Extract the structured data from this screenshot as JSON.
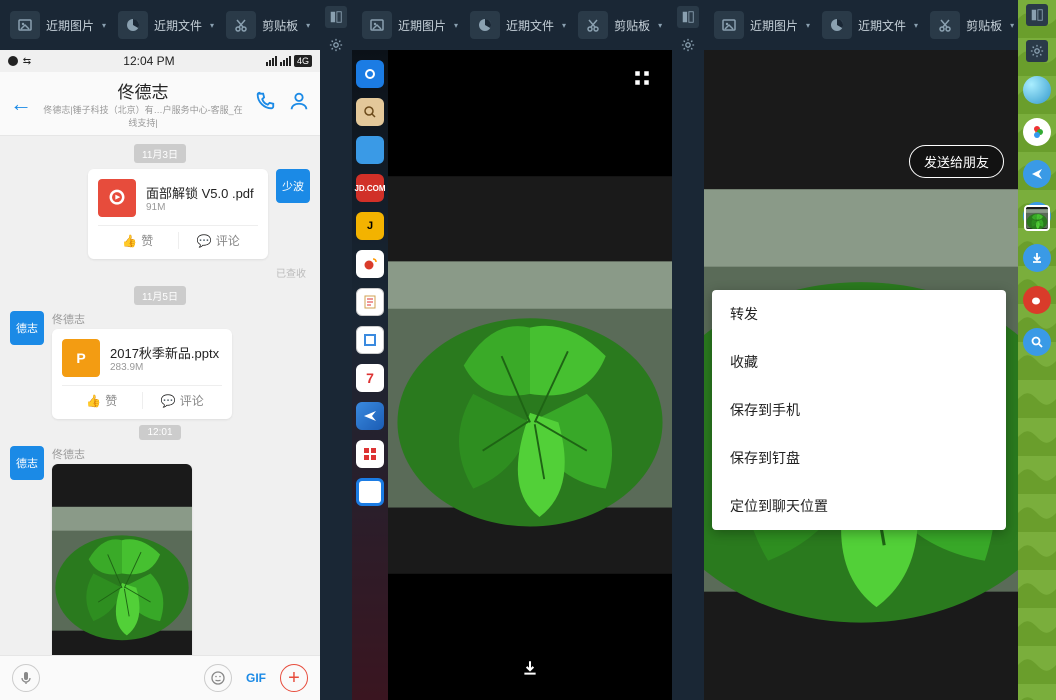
{
  "topbar": {
    "recent_images": "近期图片",
    "recent_files": "近期文件",
    "clipboard": "剪贴板"
  },
  "chat": {
    "status_time": "12:04 PM",
    "net_badge": "4G",
    "contact_name": "佟德志",
    "contact_sub": "佟德志|锤子科技（北京）有…户服务中心-客服_在线支持|",
    "avatar_out": "少波",
    "avatar_in": "德志",
    "dates": {
      "d1": "11月3日",
      "d2": "11月5日",
      "d3": "12:01"
    },
    "read": "已查收",
    "sender": "佟德志",
    "files": {
      "f1_name": "面部解锁 V5.0 .pdf",
      "f1_size": "91M",
      "f2_name": "2017秋季新品.pptx",
      "f2_size": "283.9M"
    },
    "actions": {
      "like": "赞",
      "comment": "评论"
    },
    "input": {
      "gif": "GIF"
    }
  },
  "panel3": {
    "send_friend": "发送给朋友",
    "menu": {
      "forward": "转发",
      "favorite": "收藏",
      "save_phone": "保存到手机",
      "save_dingpan": "保存到钉盘",
      "locate_chat": "定位到聊天位置"
    }
  },
  "dock": {
    "cal": "7"
  }
}
